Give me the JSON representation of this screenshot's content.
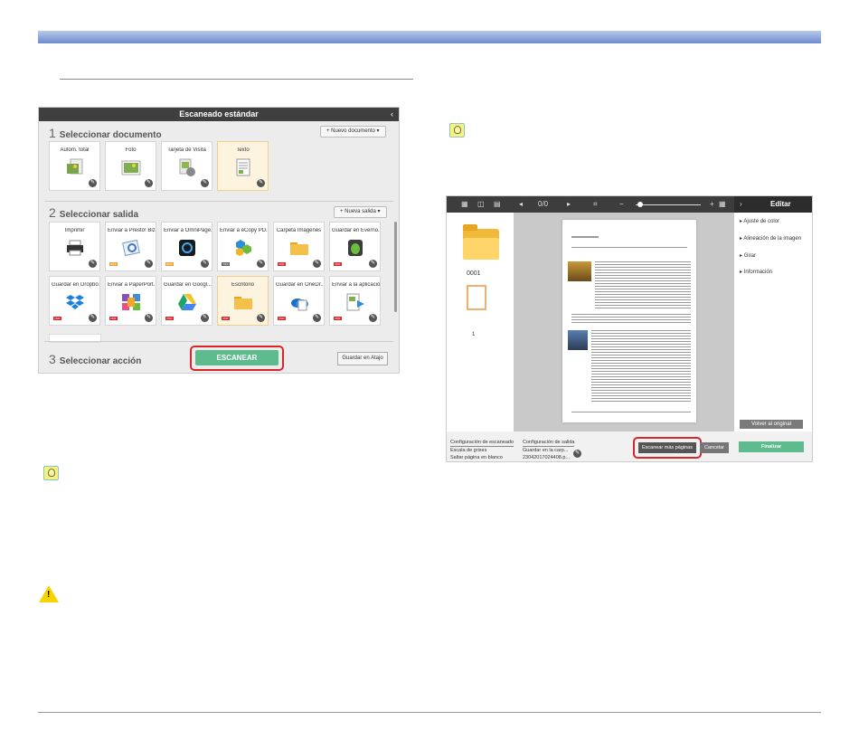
{
  "standard_scan": {
    "title": "Escaneado estándar",
    "section1": {
      "number": "1",
      "title": "Seleccionar documento",
      "button": "+ Nuevo documento ▾"
    },
    "documents": [
      {
        "label": "Autom. total",
        "icon": "photo-doc-icon"
      },
      {
        "label": "Foto",
        "icon": "photo-icon"
      },
      {
        "label": "Tarjeta de Visita",
        "icon": "business-card-icon"
      },
      {
        "label": "Texto",
        "icon": "text-doc-icon"
      }
    ],
    "section2": {
      "number": "2",
      "title": "Seleccionar salida",
      "button": "+ Nueva salida ▾"
    },
    "outputs_row1": [
      {
        "label": "Imprimir",
        "icon": "printer-icon",
        "badge": ""
      },
      {
        "label": "Enviar a Presto! Biz...",
        "icon": "presto-icon",
        "badge": "BMP"
      },
      {
        "label": "Enviar a OmniPage...",
        "icon": "omnipage-icon",
        "badge": "BMP"
      },
      {
        "label": "Enviar a eCopy PD...",
        "icon": "ecopy-icon",
        "badge": "TIFF"
      },
      {
        "label": "Carpeta Imágenes",
        "icon": "folder-icon",
        "badge": "PDF"
      },
      {
        "label": "Guardar en Everno...",
        "icon": "evernote-icon",
        "badge": "PDF"
      }
    ],
    "outputs_row2": [
      {
        "label": "Guardar en Dropbo...",
        "icon": "dropbox-icon",
        "badge": "PDF"
      },
      {
        "label": "Enviar a PaperPort...",
        "icon": "paperport-icon",
        "badge": "PDF"
      },
      {
        "label": "Guardar en Googl...",
        "icon": "google-drive-icon",
        "badge": "PDF"
      },
      {
        "label": "Escritorio",
        "icon": "folder-icon",
        "badge": "PDF"
      },
      {
        "label": "Guardar en OneDr...",
        "icon": "onedrive-icon",
        "badge": "PDF"
      },
      {
        "label": "Enviar a la aplicación",
        "icon": "app-icon",
        "badge": "PDF"
      }
    ],
    "section3": {
      "number": "3",
      "title": "Seleccionar acción"
    },
    "scan_button": "ESCANEAR",
    "shortcut_button": "Guardar en Atajo"
  },
  "editor": {
    "page_counter": "0/0",
    "edit_title": "Editar",
    "thumb_name": "0001",
    "thumb_page": "1",
    "side_items": [
      "Ajuste de color",
      "Alineación de la imagen",
      "Girar",
      "Información"
    ],
    "revert_button": "Volver al original",
    "scan_settings_title": "Configuración de escaneado",
    "scan_settings": [
      "Escala de grises",
      "Saltar página en blanco"
    ],
    "output_settings_title": "Configuración de salida",
    "output_settings": [
      "Guardar en la carp...",
      "23042017024408.p..."
    ],
    "scan_more_button": "Escanear más páginas",
    "cancel_button": "Cancelar",
    "finish_button": "Finalizar"
  },
  "colors": {
    "accent_green": "#5dbb8e",
    "highlight_red": "#d9262c",
    "header_blue": "#6d8ccf",
    "selected_tile": "#fdf4df"
  }
}
